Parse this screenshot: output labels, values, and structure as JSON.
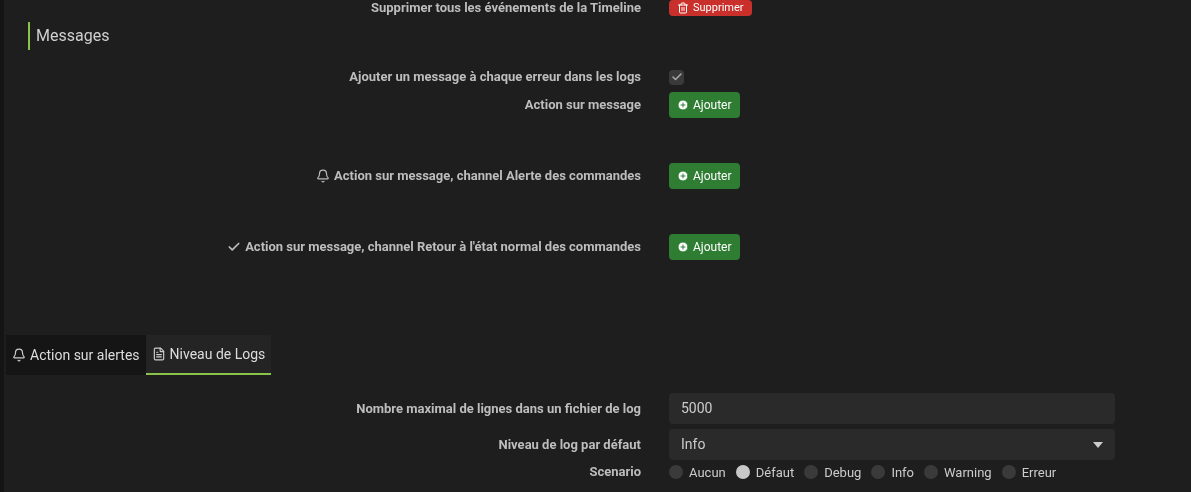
{
  "top_row": {
    "label": "Supprimer tous les événements de la Timeline",
    "button": "Supprimer"
  },
  "messages": {
    "title": "Messages",
    "rows": [
      {
        "kind": "checkbox",
        "label": "Ajouter un message à chaque erreur dans les logs",
        "checked": true
      },
      {
        "kind": "button",
        "label": "Action sur message",
        "button": "Ajouter"
      },
      {
        "kind": "button",
        "label": "Action sur message, channel Alerte des commandes",
        "button": "Ajouter"
      },
      {
        "kind": "button",
        "label": "Action sur message, channel Retour à l'état normal des commandes",
        "button": "Ajouter"
      }
    ]
  },
  "tabs": [
    {
      "label": "Action sur alertes",
      "selected": false
    },
    {
      "label": "Niveau de Logs",
      "selected": true
    }
  ],
  "logs": {
    "rows": [
      {
        "kind": "input",
        "label": "Nombre maximal de lignes dans un fichier de log",
        "value": "5000"
      },
      {
        "kind": "select",
        "label": "Niveau de log par défaut",
        "value": "Info"
      },
      {
        "kind": "radio",
        "label": "Scenario",
        "options": [
          {
            "label": "Aucun",
            "selected": false
          },
          {
            "label": "Défaut",
            "selected": true
          },
          {
            "label": "Debug",
            "selected": false
          },
          {
            "label": "Info",
            "selected": false
          },
          {
            "label": "Warning",
            "selected": false
          },
          {
            "label": "Erreur",
            "selected": false
          }
        ]
      }
    ]
  }
}
